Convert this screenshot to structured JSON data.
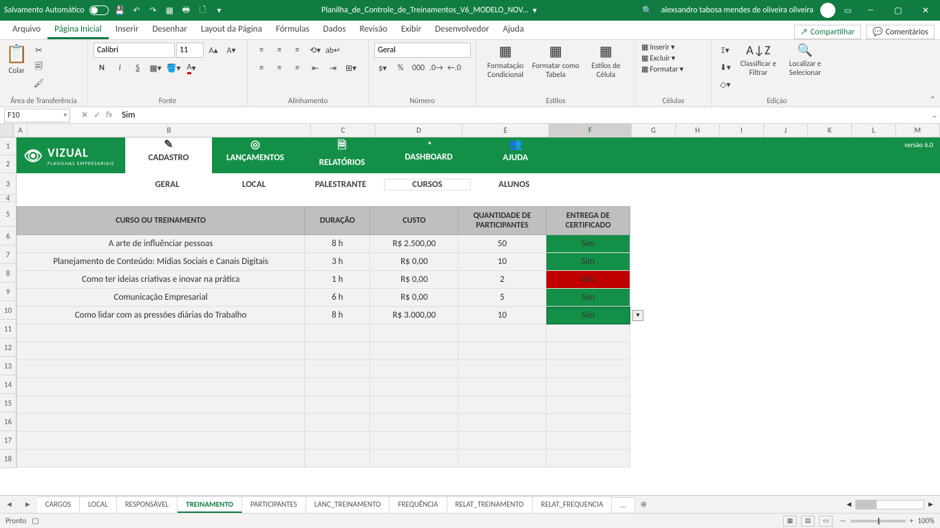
{
  "titlebar": {
    "autosave": "Salvamento Automático",
    "filename": "Planilha_de_Controle_de_Treinamentos_V6_MODELO_NOV...",
    "user": "alexsandro tabosa mendes de oliveira oliveira"
  },
  "menu": {
    "tabs": [
      "Arquivo",
      "Página Inicial",
      "Inserir",
      "Desenhar",
      "Layout da Página",
      "Fórmulas",
      "Dados",
      "Revisão",
      "Exibir",
      "Desenvolvedor",
      "Ajuda"
    ],
    "active": 1,
    "share": "Compartilhar",
    "comments": "Comentários"
  },
  "ribbon": {
    "clipboard": {
      "paste": "Colar",
      "label": "Área de Transferência"
    },
    "font": {
      "name": "Calibri",
      "size": "11",
      "label": "Fonte"
    },
    "alignment": {
      "label": "Alinhamento"
    },
    "number": {
      "format": "Geral",
      "label": "Número"
    },
    "styles": {
      "cond": "Formatação Condicional",
      "table": "Formatar como Tabela",
      "cell": "Estilos de Célula",
      "label": "Estilos"
    },
    "cells": {
      "insert": "Inserir",
      "delete": "Excluir",
      "format": "Formatar",
      "label": "Células"
    },
    "editing": {
      "sort": "Classificar e Filtrar",
      "find": "Localizar e Selecionar",
      "label": "Edição"
    }
  },
  "fx": {
    "ref": "F10",
    "value": "Sim"
  },
  "cols": [
    "A",
    "B",
    "C",
    "D",
    "E",
    "F",
    "G",
    "H",
    "I",
    "J",
    "K",
    "L",
    "M"
  ],
  "rows": [
    "1",
    "2",
    "3",
    "4",
    "5",
    "6",
    "7",
    "8",
    "9",
    "10",
    "11",
    "12",
    "13",
    "14",
    "15",
    "16",
    "17",
    "18"
  ],
  "app": {
    "brand": "VIZUAL",
    "brand_sub": "PLANILHAS EMPRESARIAIS",
    "version": "versão 6.0",
    "maintabs": [
      {
        "label": "CADASTRO",
        "icon": "✎"
      },
      {
        "label": "LANÇAMENTOS",
        "icon": "◎"
      },
      {
        "label": "RELATÓRIOS",
        "icon": "🗎"
      },
      {
        "label": "DASHBOARD",
        "icon": "◔"
      },
      {
        "label": "AJUDA",
        "icon": "👥"
      }
    ],
    "active_main": 0,
    "subtabs": [
      "GERAL",
      "LOCAL",
      "PALESTRANTE",
      "CURSOS",
      "ALUNOS"
    ],
    "active_sub": 3
  },
  "table": {
    "headers": [
      "CURSO OU TREINAMENTO",
      "DURAÇÃO",
      "CUSTO",
      "QUANTIDADE DE PARTICIPANTES",
      "ENTREGA DE CERTIFICADO"
    ],
    "rows": [
      {
        "name": "A arte de influênciar pessoas",
        "dur": "8 h",
        "cost": "R$ 2.500,00",
        "qty": "50",
        "cert": "Sim"
      },
      {
        "name": "Planejamento de Conteúdo: Mídias Sociais e Canais Digitais",
        "dur": "3 h",
        "cost": "R$ 0,00",
        "qty": "10",
        "cert": "Sim"
      },
      {
        "name": "Como ter ideias criativas e inovar na prática",
        "dur": "1 h",
        "cost": "R$ 0,00",
        "qty": "2",
        "cert": "Não"
      },
      {
        "name": "Comunicação Empresarial",
        "dur": "6 h",
        "cost": "R$ 0,00",
        "qty": "5",
        "cert": "Sim"
      },
      {
        "name": "Como lidar com as pressões diárias do Trabalho",
        "dur": "8 h",
        "cost": "R$ 3.000,00",
        "qty": "10",
        "cert": "Sim"
      }
    ],
    "selected_row": 4
  },
  "sheets": {
    "tabs": [
      "CARGOS",
      "LOCAL",
      "RESPONSÁVEL",
      "TREINAMENTO",
      "PARTICIPANTES",
      "LANC_TREINAMENTO",
      "FREQUÊNCIA",
      "RELAT_TREINAMENTO",
      "RELAT_FREQUENCIA"
    ],
    "more": "...",
    "active": 3
  },
  "status": {
    "ready": "Pronto",
    "zoom": "100%"
  }
}
